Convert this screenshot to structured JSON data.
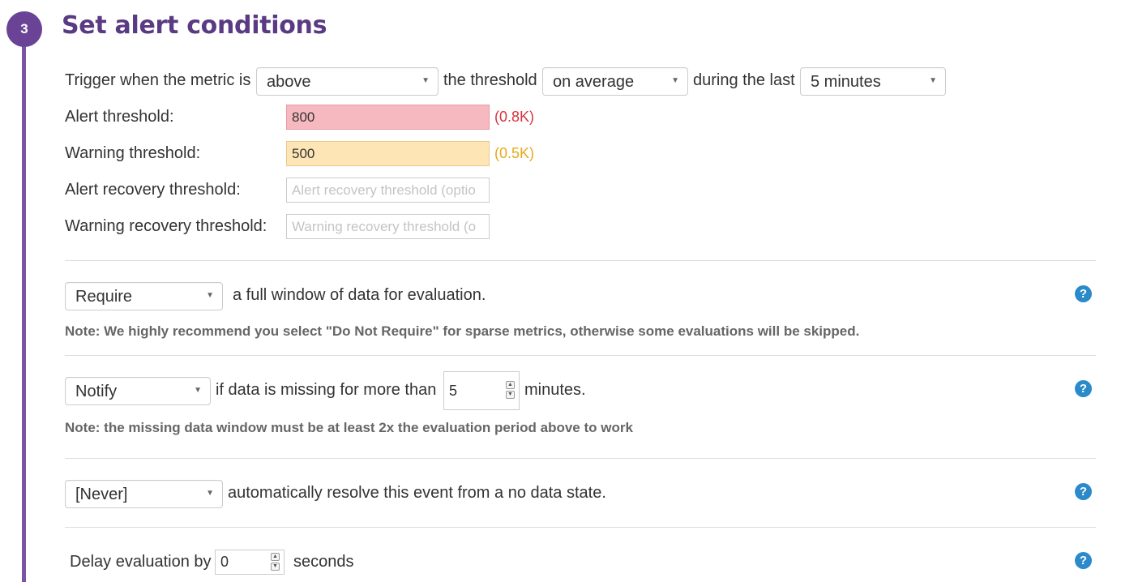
{
  "step": {
    "number": "3",
    "title": "Set alert conditions"
  },
  "trigger": {
    "prefix": "Trigger when the metric is",
    "comparator": "above",
    "middle": "the threshold",
    "aggregation": "on average",
    "suffix": "during the last",
    "timeframe": "5 minutes"
  },
  "thresholds": {
    "alert": {
      "label": "Alert threshold:",
      "value": "800",
      "hint": "(0.8K)"
    },
    "warning": {
      "label": "Warning threshold:",
      "value": "500",
      "hint": "(0.5K)"
    },
    "alert_recovery": {
      "label": "Alert recovery threshold:",
      "placeholder": "Alert recovery threshold (optio"
    },
    "warning_recovery": {
      "label": "Warning recovery threshold:",
      "placeholder": "Warning recovery threshold (o"
    }
  },
  "full_window": {
    "select": "Require",
    "text": "a full window of data for evaluation.",
    "note": "Note: We highly recommend you select \"Do Not Require\" for sparse metrics, otherwise some evaluations will be skipped."
  },
  "missing_data": {
    "select": "Notify",
    "text": "if data is missing for more than",
    "minutes_value": "5",
    "suffix": "minutes.",
    "note": "Note: the missing data window must be at least 2x the evaluation period above to work"
  },
  "auto_resolve": {
    "select": "[Never]",
    "text": "automatically resolve this event from a no data state."
  },
  "delay": {
    "prefix": "Delay evaluation by",
    "value": "0",
    "suffix": "seconds"
  },
  "help_glyph": "?",
  "colors": {
    "accent": "#6a4396",
    "alert": "#d9333f",
    "warning": "#e8a81b",
    "help": "#2b8ac9"
  },
  "icons": [
    "caret-down-icon",
    "spinner-up-icon",
    "spinner-down-icon",
    "help-icon"
  ]
}
